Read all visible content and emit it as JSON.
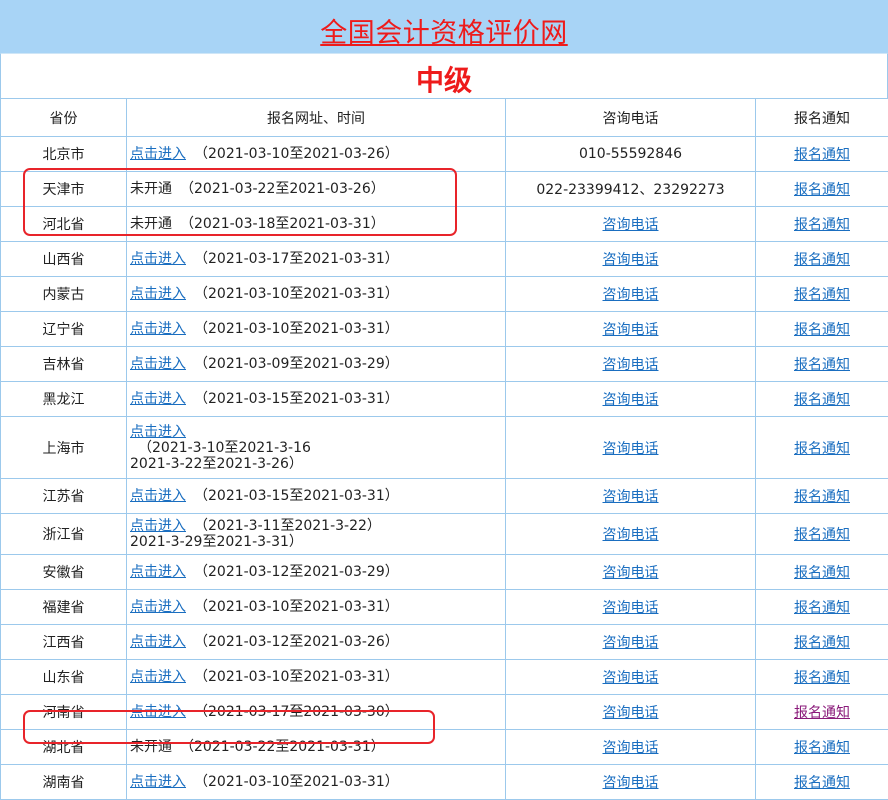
{
  "site_title": "全国会计资格评价网",
  "level": "中级",
  "headers": [
    "省份",
    "报名网址、时间",
    "咨询电话",
    "报名通知"
  ],
  "rows": [
    {
      "province": "北京市",
      "status": "点击进入",
      "linked": true,
      "dates": [
        "（2021-03-10至2021-03-26）"
      ],
      "tel": "010-55592846",
      "notice": "报名通知"
    },
    {
      "province": "天津市",
      "status": "未开通",
      "linked": false,
      "dates": [
        "（2021-03-22至2021-03-26）"
      ],
      "tel": "022-23399412、23292273",
      "notice": "报名通知"
    },
    {
      "province": "河北省",
      "status": "未开通",
      "linked": false,
      "dates": [
        "（2021-03-18至2021-03-31）"
      ],
      "tel": "咨询电话",
      "tel_link": true,
      "notice": "报名通知"
    },
    {
      "province": "山西省",
      "status": "点击进入",
      "linked": true,
      "dates": [
        "（2021-03-17至2021-03-31）"
      ],
      "tel": "咨询电话",
      "tel_link": true,
      "notice": "报名通知"
    },
    {
      "province": "内蒙古",
      "status": "点击进入",
      "linked": true,
      "dates": [
        "（2021-03-10至2021-03-31）"
      ],
      "tel": "咨询电话",
      "tel_link": true,
      "notice": "报名通知"
    },
    {
      "province": "辽宁省",
      "status": "点击进入",
      "linked": true,
      "dates": [
        "（2021-03-10至2021-03-31）"
      ],
      "tel": "咨询电话",
      "tel_link": true,
      "notice": "报名通知"
    },
    {
      "province": "吉林省",
      "status": "点击进入",
      "linked": true,
      "dates": [
        "（2021-03-09至2021-03-29）"
      ],
      "tel": "咨询电话",
      "tel_link": true,
      "notice": "报名通知"
    },
    {
      "province": "黑龙江",
      "status": "点击进入",
      "linked": true,
      "dates": [
        "（2021-03-15至2021-03-31）"
      ],
      "tel": "咨询电话",
      "tel_link": true,
      "notice": "报名通知"
    },
    {
      "province": "上海市",
      "status": "点击进入",
      "linked": true,
      "stacked": true,
      "dates": [
        "（2021-3-10至2021-3-16",
        "2021-3-22至2021-3-26）"
      ],
      "tel": "咨询电话",
      "tel_link": true,
      "notice": "报名通知"
    },
    {
      "province": "江苏省",
      "status": "点击进入",
      "linked": true,
      "dates": [
        "（2021-03-15至2021-03-31）"
      ],
      "tel": "咨询电话",
      "tel_link": true,
      "notice": "报名通知"
    },
    {
      "province": "浙江省",
      "status": "点击进入",
      "linked": true,
      "dates": [
        "（2021-3-11至2021-3-22）",
        "2021-3-29至2021-3-31）"
      ],
      "tel": "咨询电话",
      "tel_link": true,
      "notice": "报名通知"
    },
    {
      "province": "安徽省",
      "status": "点击进入",
      "linked": true,
      "dates": [
        "（2021-03-12至2021-03-29）"
      ],
      "tel": "咨询电话",
      "tel_link": true,
      "notice": "报名通知"
    },
    {
      "province": "福建省",
      "status": "点击进入",
      "linked": true,
      "dates": [
        "（2021-03-10至2021-03-31）"
      ],
      "tel": "咨询电话",
      "tel_link": true,
      "notice": "报名通知"
    },
    {
      "province": "江西省",
      "status": "点击进入",
      "linked": true,
      "dates": [
        "（2021-03-12至2021-03-26）"
      ],
      "tel": "咨询电话",
      "tel_link": true,
      "notice": "报名通知"
    },
    {
      "province": "山东省",
      "status": "点击进入",
      "linked": true,
      "dates": [
        "（2021-03-10至2021-03-31）"
      ],
      "tel": "咨询电话",
      "tel_link": true,
      "notice": "报名通知"
    },
    {
      "province": "河南省",
      "status": "点击进入",
      "linked": true,
      "dates": [
        "（2021-03-17至2021-03-30）"
      ],
      "tel": "咨询电话",
      "tel_link": true,
      "notice": "报名通知",
      "notice_visited": true
    },
    {
      "province": "湖北省",
      "status": "未开通",
      "linked": false,
      "dates": [
        "（2021-03-22至2021-03-31）"
      ],
      "tel": "咨询电话",
      "tel_link": true,
      "notice": "报名通知"
    },
    {
      "province": "湖南省",
      "status": "点击进入",
      "linked": true,
      "dates": [
        "（2021-03-10至2021-03-31）"
      ],
      "tel": "咨询电话",
      "tel_link": true,
      "notice": "报名通知"
    }
  ],
  "colors": {
    "banner_bg": "#a8d4f6",
    "title_red": "#ee1b1b",
    "link_blue": "#1a6ec0",
    "link_visited": "#8a1a7a",
    "border": "#9cc9ec",
    "highlight_red": "#e8242a"
  }
}
